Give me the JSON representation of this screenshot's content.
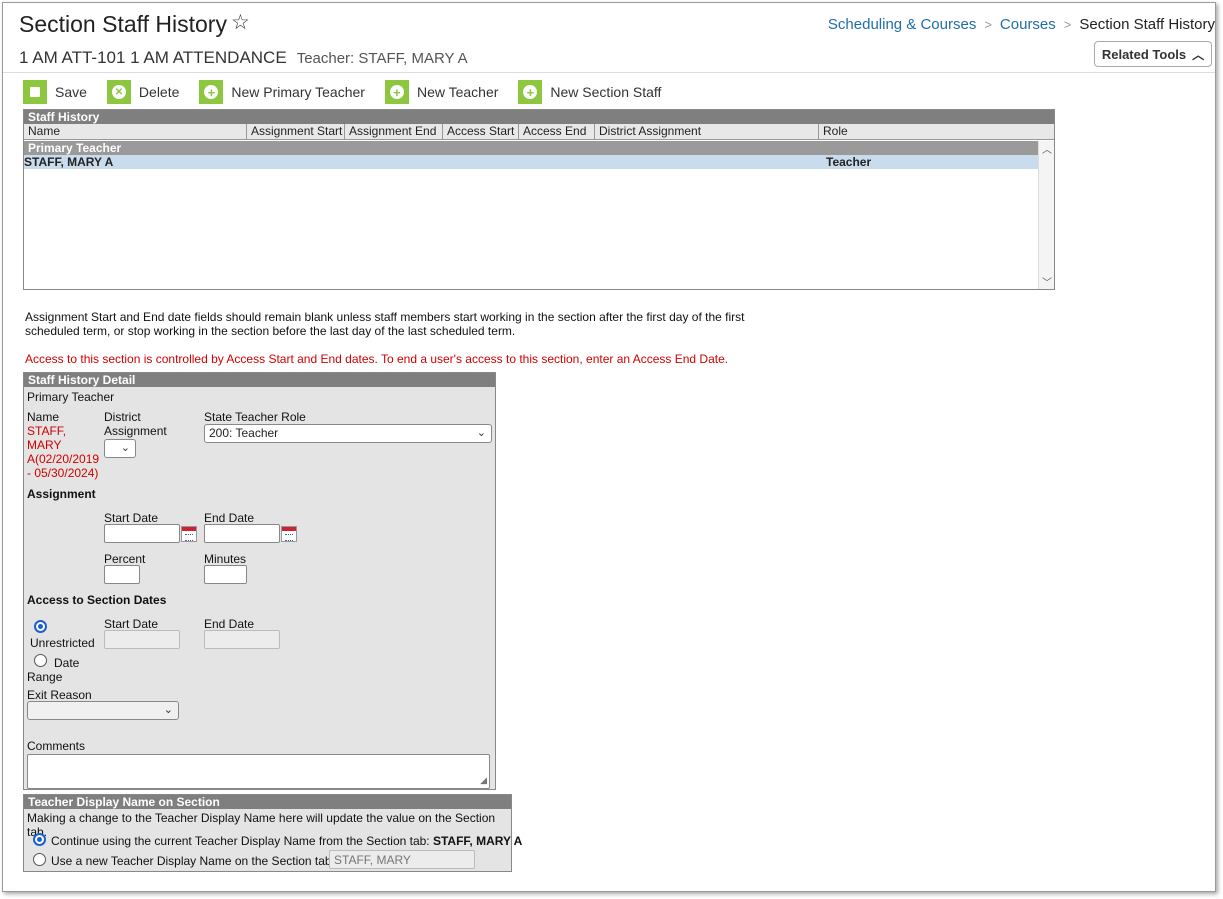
{
  "header": {
    "title": "Section Staff History",
    "subtitle": "1 AM ATT-101 1 AM ATTENDANCE",
    "teacher": "Teacher: STAFF, MARY A",
    "related_tools": "Related Tools"
  },
  "breadcrumb": {
    "item1": "Scheduling & Courses",
    "item2": "Courses",
    "current": "Section Staff History"
  },
  "toolbar": {
    "save": "Save",
    "delete": "Delete",
    "new_primary": "New Primary Teacher",
    "new_teacher": "New Teacher",
    "new_section_staff": "New Section Staff"
  },
  "staff_history": {
    "title": "Staff History",
    "columns": [
      "Name",
      "Assignment Start",
      "Assignment End",
      "Access Start",
      "Access End",
      "District Assignment",
      "Role"
    ],
    "group": "Primary Teacher",
    "row": {
      "name": "STAFF, MARY A",
      "role": "Teacher"
    }
  },
  "notes": {
    "info": "Assignment Start and End date fields should remain blank unless staff members start working in the section after the first day of the first scheduled term, or stop working in the section before the last day of the last scheduled term.",
    "warning": "Access to this section is controlled by Access Start and End dates. To end a user's access to this section, enter an Access End Date."
  },
  "detail": {
    "title": "Staff History Detail",
    "section": "Primary Teacher",
    "name_label": "Name",
    "name_value_1": "STAFF,",
    "name_value_2": "MARY",
    "name_value_3": "A(02/20/2019",
    "name_value_4": "- 05/30/2024)",
    "district_label_1": "District",
    "district_label_2": "Assignment",
    "state_role_label": "State Teacher Role",
    "state_role_value": "200: Teacher",
    "assignment_heading": "Assignment",
    "start_date": "Start Date",
    "end_date": "End Date",
    "percent": "Percent",
    "minutes": "Minutes",
    "access_heading": "Access to Section Dates",
    "unrestricted": "Unrestricted",
    "date_range_1": "Date",
    "date_range_2": "Range",
    "exit_reason": "Exit Reason",
    "comments": "Comments"
  },
  "display_name": {
    "title": "Teacher Display Name on Section",
    "note": "Making a change to the Teacher Display Name here will update the value on the Section tab.",
    "option1": "Continue using the current Teacher Display Name from the Section tab: ",
    "option1_value": "STAFF, MARY A",
    "option2": "Use a new Teacher Display Name on the Section tab:",
    "option2_placeholder": "STAFF, MARY"
  }
}
